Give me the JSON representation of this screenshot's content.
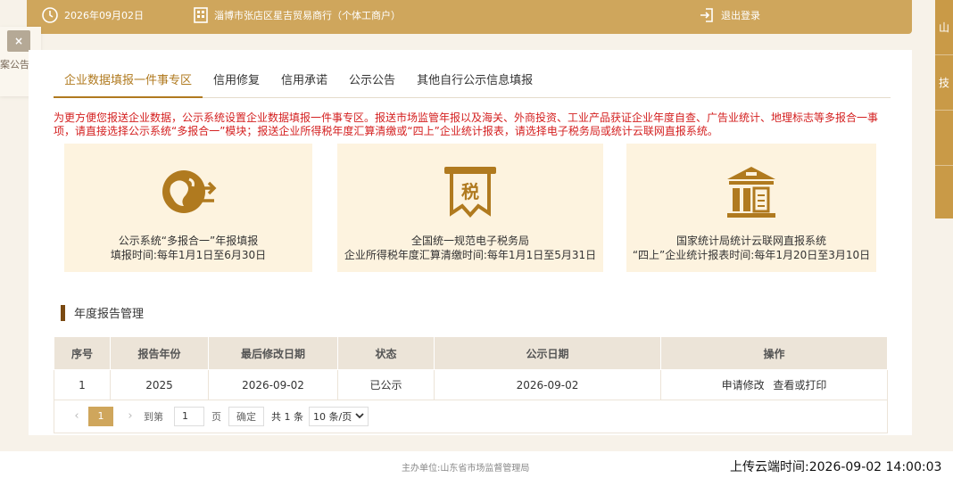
{
  "header": {
    "date": "2026年09月02日",
    "company": "淄博市张店区星吉贸易商行（个体工商户）",
    "logout": "退出登录"
  },
  "left_panel": {
    "close": "×",
    "text": "案公告"
  },
  "right_sidebar": {
    "items": [
      "山",
      "技"
    ]
  },
  "tabs": [
    {
      "label": "企业数据填报一件事专区",
      "active": true
    },
    {
      "label": "信用修复"
    },
    {
      "label": "信用承诺"
    },
    {
      "label": "公示公告"
    },
    {
      "label": "其他自行公示信息填报"
    }
  ],
  "notice": "为更方便您报送企业数据，公示系统设置企业数据填报一件事专区。报送市场监管年报以及海关、外商投资、工业产品获证企业年度自查、广告业统计、地理标志等多报合一事项，请直接选择公示系统“多报合一”模块；报送企业所得税年度汇算清缴或“四上”企业统计报表，请选择电子税务局或统计云联网直报系统。",
  "services": [
    {
      "icon": "globe-exchange-icon",
      "line1": "公示系统“多报合一”年报填报",
      "line2": "填报时间:每年1月1日至6月30日"
    },
    {
      "icon": "tax-scroll-icon",
      "line1": "全国统一规范电子税务局",
      "line2": "企业所得税年度汇算清缴时间:每年1月1日至5月31日",
      "icon_text": "税"
    },
    {
      "icon": "bank-building-icon",
      "line1": "国家统计局统计云联网直报系统",
      "line2": "“四上”企业统计报表时间:每年1月20日至3月10日"
    }
  ],
  "section_title": "年度报告管理",
  "table": {
    "headers": [
      "序号",
      "报告年份",
      "最后修改日期",
      "状态",
      "公示日期",
      "操作"
    ],
    "rows": [
      {
        "no": "1",
        "year": "2025",
        "modified": "2026-09-02",
        "status": "已公示",
        "public_date": "2026-09-02",
        "action1": "申请修改",
        "action2": "查看或打印"
      }
    ]
  },
  "pager": {
    "prev": "‹",
    "next": "›",
    "current": "1",
    "goto_label": "到第",
    "goto_value": "1",
    "page_unit": "页",
    "confirm": "确定",
    "total": "共 1 条",
    "page_size": "10 条/页"
  },
  "footer": {
    "host": "主办单位:山东省市场监督管理局",
    "upload_time": "上传云端时间:2026-09-02 14:00:03"
  },
  "colors": {
    "gold": "#cfa65c",
    "brown": "#b07a1f",
    "notice_red": "#d42020",
    "box_bg": "#fdf3df"
  }
}
